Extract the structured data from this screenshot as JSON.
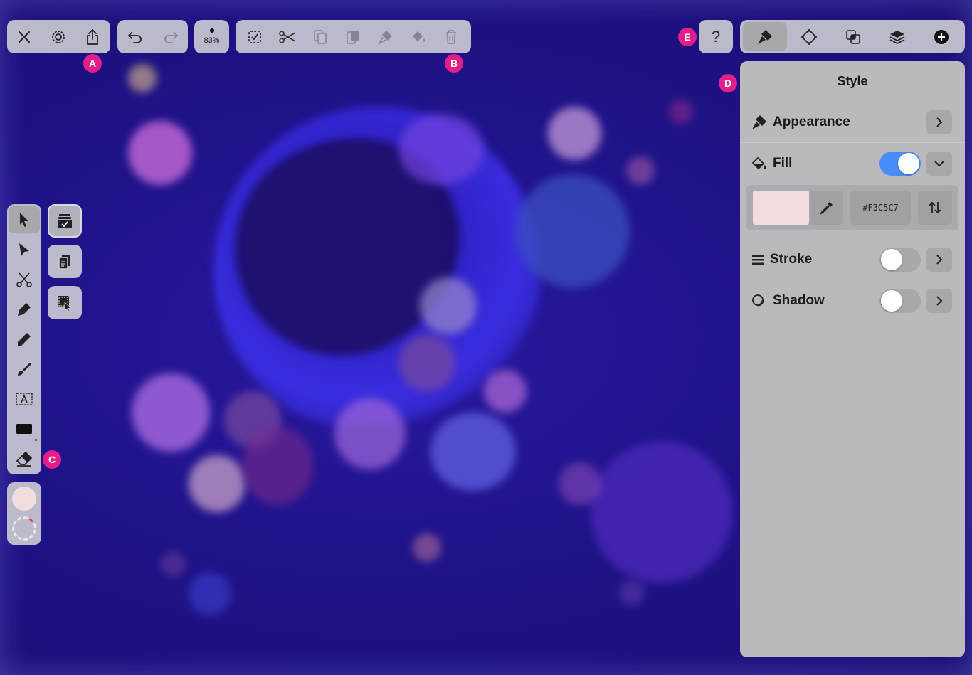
{
  "top_left_bar": {
    "buttons": [
      {
        "name": "close-button",
        "icon": "close-icon"
      },
      {
        "name": "settings-button",
        "icon": "gear-icon"
      },
      {
        "name": "share-button",
        "icon": "share-icon"
      }
    ]
  },
  "history_bar": {
    "undo_icon": "undo-icon",
    "redo_icon": "redo-icon"
  },
  "zoom": {
    "label": "83%"
  },
  "edit_bar": {
    "buttons": [
      "select-all-icon",
      "cut-icon",
      "copy-icon",
      "paste-icon",
      "copy-style-icon",
      "paste-style-icon",
      "delete-icon"
    ]
  },
  "callouts": {
    "a": "A",
    "b": "B",
    "c": "C",
    "d": "D",
    "e": "E"
  },
  "help": {
    "label": "?"
  },
  "panel_tabs": [
    "style-tab-icon",
    "shape-tab-icon",
    "arrange-tab-icon",
    "layers-tab-icon",
    "add-icon"
  ],
  "style_panel": {
    "title": "Style",
    "appearance": {
      "label": "Appearance"
    },
    "fill": {
      "label": "Fill",
      "enabled": true,
      "color": "#F3DCDD",
      "hex_label": "#F3C5C7"
    },
    "stroke": {
      "label": "Stroke",
      "enabled": false
    },
    "shadow": {
      "label": "Shadow",
      "enabled": false
    }
  },
  "colors": {
    "accent_blue": "#4a8cf7",
    "tag_magenta": "#e31e8a",
    "fill_swatch": "#F3DCDD"
  }
}
